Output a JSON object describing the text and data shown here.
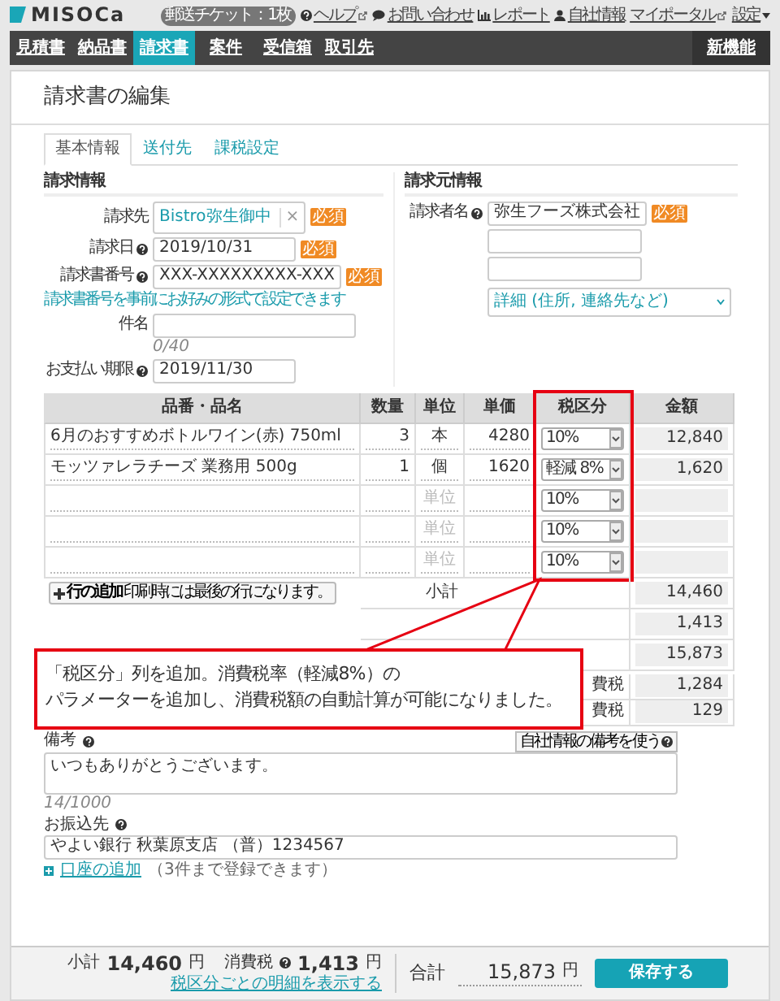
{
  "header": {
    "logo": "MISOCa",
    "ticket_badge": "郵送チケット：1枚",
    "links": [
      {
        "label": "ヘルプ",
        "kind": "help",
        "external": true
      },
      {
        "label": "お問い合わせ",
        "kind": "contact",
        "external": false
      },
      {
        "label": "レポート",
        "kind": "report",
        "external": false
      },
      {
        "label": "自社情報",
        "kind": "company",
        "external": false
      },
      {
        "label": "マイポータル",
        "kind": "portal",
        "external": true
      },
      {
        "label": "設定",
        "kind": "settings",
        "external": false
      }
    ]
  },
  "nav": {
    "items": [
      {
        "label": "見積書",
        "selected": false
      },
      {
        "label": "納品書",
        "selected": false
      },
      {
        "label": "請求書",
        "selected": true
      },
      {
        "label": "案件",
        "selected": false
      },
      {
        "label": "受信箱",
        "selected": false
      },
      {
        "label": "取引先",
        "selected": false
      }
    ],
    "new_features": "新機能"
  },
  "page_title": "請求書の編集",
  "tabs": [
    {
      "label": "基本情報",
      "selected": true
    },
    {
      "label": "送付先",
      "selected": false
    },
    {
      "label": "課税設定",
      "selected": false
    }
  ],
  "billing_info": {
    "heading": "請求情報",
    "client": {
      "label": "請求先",
      "value": "Bistro弥生御中",
      "remove": "×",
      "required": "必須"
    },
    "fields": [
      {
        "label": "請求日",
        "help": true,
        "value": "2019/10/31",
        "required": "必須"
      },
      {
        "label": "請求書番号",
        "help": true,
        "value": "XXX-XXXXXXXXX-XXX",
        "required": "必須",
        "hint": "請求書番号を事前にお好みの形式で設定できます"
      },
      {
        "label": "件名",
        "help": false,
        "counter": "0/40"
      },
      {
        "label": "お支払い期限",
        "help": true,
        "value": "2019/11/30"
      }
    ]
  },
  "issuer_info": {
    "heading": "請求元情報",
    "label": "請求者名",
    "help": true,
    "value": "弥生フーズ株式会社",
    "required": "必須",
    "details": "詳細 (住所, 連絡先など)"
  },
  "items": {
    "columns": [
      "品番・品名",
      "数量",
      "単位",
      "単価",
      "税区分",
      "金額"
    ],
    "rows": [
      {
        "name": "6月のおすすめボトルワイン(赤) 750ml",
        "quantity": "3",
        "unit": "本",
        "unit_price": "4280",
        "tax_category": "10%",
        "amount": "12,840"
      },
      {
        "name": "モッツァレラチーズ 業務用 500g",
        "quantity": "1",
        "unit": "個",
        "unit_price": "1620",
        "tax_category": "軽減 8%",
        "amount": "1,620"
      },
      {
        "unit_placeholder": "単位",
        "tax_category": "10%"
      },
      {
        "unit_placeholder": "単位",
        "tax_category": "10%"
      },
      {
        "unit_placeholder": "単位",
        "tax_category": "10%"
      }
    ],
    "add_row": {
      "label": "行の追加",
      "note": "印刷時には最後の行になります。"
    },
    "summary": [
      {
        "label": "小計",
        "amount": "14,460"
      },
      {
        "amount": "1,413"
      },
      {
        "amount": "15,873"
      }
    ],
    "tax_breakdown": [
      {
        "label": "費税",
        "amount": "1,284"
      },
      {
        "label": "費税",
        "amount": "129"
      }
    ]
  },
  "annotation": {
    "lines": [
      "「税区分」列を追加。消費税率（軽減8%）の",
      "パラメーターを追加し、消費税額の自動計算が可能になりました。"
    ]
  },
  "remarks": {
    "label": "備考",
    "help": true,
    "button": "自社情報の備考を使う",
    "value": "いつもありがとうございます。",
    "counter": "14/1000"
  },
  "bank": {
    "label": "お振込先",
    "help": true,
    "value": "やよい銀行 秋葉原支店 （普）1234567",
    "add_link": "口座の追加",
    "note": "（3件まで登録できます）"
  },
  "footer": {
    "subtotal_label": "小計",
    "subtotal": "14,460",
    "subtotal_unit": "円",
    "tax_label": "消費税",
    "tax_help": true,
    "tax": "1,413",
    "tax_unit": "円",
    "breakdown_link": "税区分ごとの明細を表示する",
    "total_label": "合計",
    "total": "15,873",
    "total_unit": "円",
    "save": "保存する"
  }
}
